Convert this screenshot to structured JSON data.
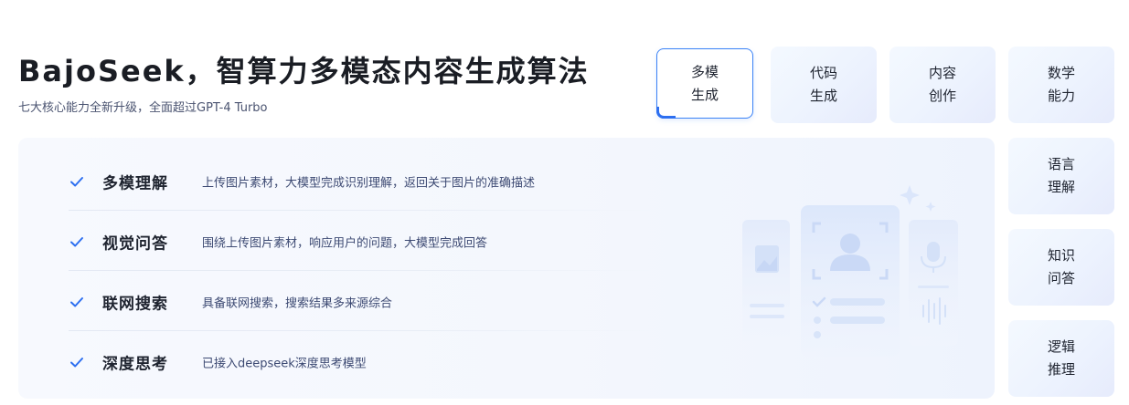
{
  "header": {
    "title": "BajoSeek，智算力多模态内容生成算法",
    "subtitle": "七大核心能力全新升级，全面超过GPT-4 Turbo"
  },
  "features": [
    {
      "name": "多模理解",
      "desc": "上传图片素材，大模型完成识别理解，返回关于图片的准确描述",
      "icon": "check-icon"
    },
    {
      "name": "视觉问答",
      "desc": "围绕上传图片素材，响应用户的问题，大模型完成回答",
      "icon": "check-icon"
    },
    {
      "name": "联网搜索",
      "desc": "具备联网搜索，搜索结果多来源综合",
      "icon": "check-icon"
    },
    {
      "name": "深度思考",
      "desc": "已接入deepseek深度思考模型",
      "icon": "check-icon"
    }
  ],
  "tabs": [
    {
      "label": "多模生成",
      "active": true
    },
    {
      "label": "代码生成",
      "active": false
    },
    {
      "label": "内容创作",
      "active": false
    },
    {
      "label": "数学能力",
      "active": false
    },
    {
      "label": "语言理解",
      "active": false
    },
    {
      "label": "知识问答",
      "active": false
    },
    {
      "label": "逻辑推理",
      "active": false
    }
  ],
  "colors": {
    "accent": "#2d6ff0",
    "check": "#2d6ff0",
    "title": "#1a1d24",
    "description": "#3d4a73"
  }
}
